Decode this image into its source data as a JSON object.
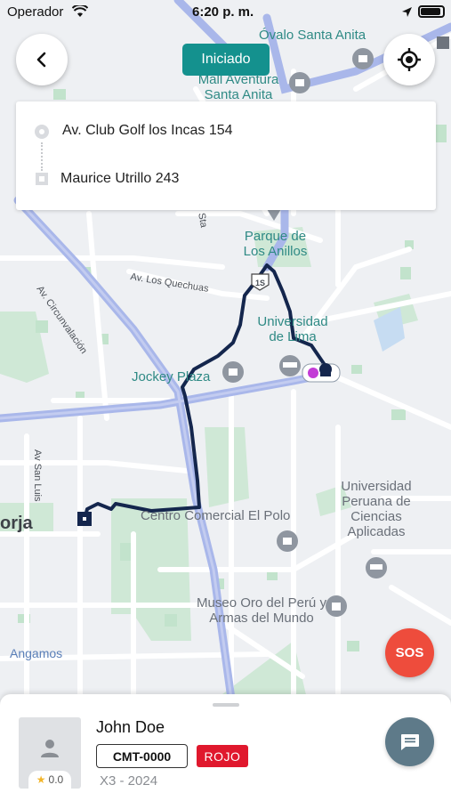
{
  "status_bar": {
    "carrier": "Operador",
    "time": "6:20 p. m."
  },
  "trip": {
    "status": "Iniciado",
    "origin": "Av. Club Golf los Incas 154",
    "destination": "Maurice Utrillo 243"
  },
  "map": {
    "places": [
      "Óvalo Santa Anita",
      "Mall Aventura Santa Anita",
      "Parque de Los Anillos",
      "Universidad de Lima",
      "Jockey Plaza",
      "Universidad Peruana de Ciencias Aplicadas",
      "Centro Comercial El Polo",
      "Museo Oro del Perú y Armas del Mundo",
      "Angamos",
      "orja"
    ],
    "roads": [
      "Av. Circunvalación",
      "Av. Los Quechuas",
      "Av San Luis",
      "Sta",
      "1S"
    ]
  },
  "actions": {
    "sos_label": "SOS"
  },
  "driver": {
    "name": "John Doe",
    "rating": "0.0",
    "plate": "CMT-0000",
    "color": "ROJO",
    "vehicle": "X3 - 2024"
  },
  "colors": {
    "accent_teal": "#14918e",
    "route": "#14264d",
    "sos": "#ee4c3c",
    "color_badge": "#e0182d",
    "chat": "#5e7a89"
  }
}
